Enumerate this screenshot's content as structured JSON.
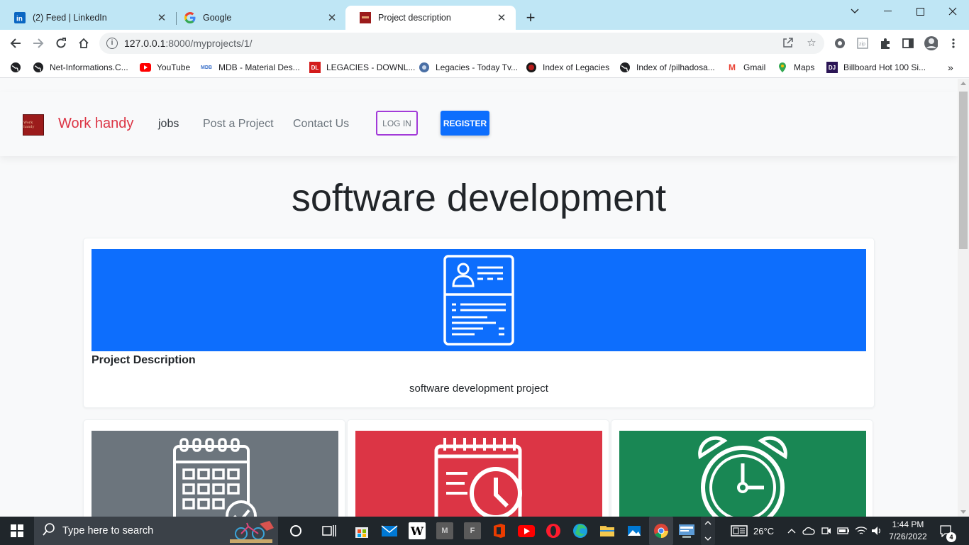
{
  "browser": {
    "tabs": [
      {
        "label": "(2) Feed | LinkedIn",
        "icon": "linkedin-icon",
        "active": false
      },
      {
        "label": "Google",
        "icon": "google-icon",
        "active": false
      },
      {
        "label": "Project description",
        "icon": "workhandy-favicon",
        "active": true
      }
    ],
    "url_host": "127.0.0.1",
    "url_rest": ":8000/myprojects/1/",
    "bookmarks": [
      {
        "label": "Net-Informations.C...",
        "icon": "globe-icon"
      },
      {
        "label": "YouTube",
        "icon": "youtube-icon"
      },
      {
        "label": "MDB - Material Des...",
        "icon": "mdb-icon",
        "badge": "MDB"
      },
      {
        "label": "LEGACIES - DOWNL...",
        "icon": "legacies-icon",
        "badge": "DL"
      },
      {
        "label": "Legacies - Today Tv...",
        "icon": "legacies-tv-icon"
      },
      {
        "label": "Index of Legacies",
        "icon": "index-icon"
      },
      {
        "label": "Index of /pilhadosa...",
        "icon": "globe-icon"
      },
      {
        "label": "Gmail",
        "icon": "gmail-icon",
        "badge": "M"
      },
      {
        "label": "Maps",
        "icon": "maps-icon"
      },
      {
        "label": "Billboard Hot 100 Si...",
        "icon": "billboard-icon",
        "badge": "DJ"
      }
    ]
  },
  "site": {
    "brand": "Work handy",
    "logo_text": "Work handy",
    "nav": {
      "jobs": "jobs",
      "post": "Post a Project",
      "contact": "Contact Us",
      "login": "LOG IN",
      "register": "REGISTER"
    },
    "page_title": "software development",
    "card": {
      "title": "Project Description",
      "text": "software development project",
      "banner_color": "#0d6efd"
    },
    "sub_cards": [
      {
        "icon": "calendar-check-icon",
        "color": "#6c757d"
      },
      {
        "icon": "calendar-clock-icon",
        "color": "#dc3545"
      },
      {
        "icon": "alarm-clock-icon",
        "color": "#198754"
      }
    ]
  },
  "taskbar": {
    "search_placeholder": "Type here to search",
    "weather": "26°C",
    "time": "1:44 PM",
    "date": "7/26/2022",
    "notifications": "4"
  }
}
